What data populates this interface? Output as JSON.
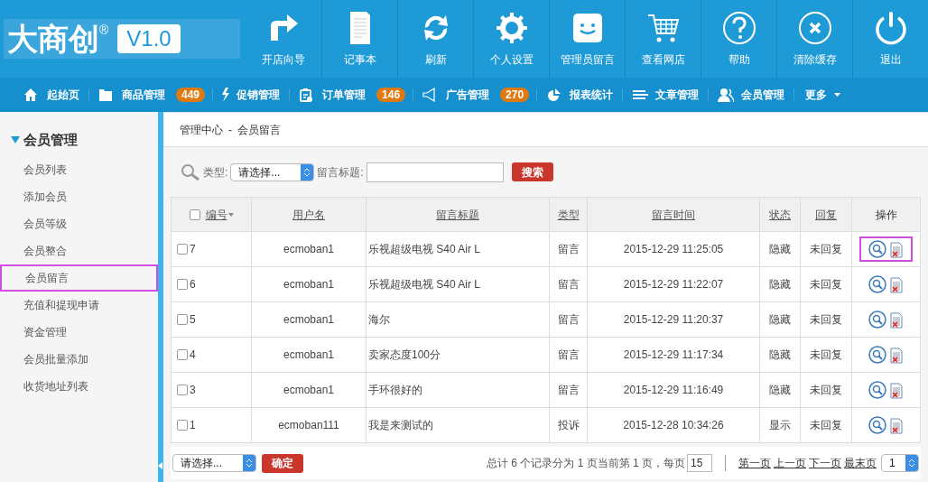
{
  "logo": {
    "text": "大商创",
    "mark": "®",
    "version": "V1.0"
  },
  "toolbar": [
    {
      "label": "开店向导",
      "kind": "arrow"
    },
    {
      "label": "记事本",
      "kind": "note"
    },
    {
      "label": "刷新",
      "kind": "refresh"
    },
    {
      "label": "个人设置",
      "kind": "gear"
    },
    {
      "label": "管理员留言",
      "kind": "smile"
    },
    {
      "label": "查看网店",
      "kind": "cart"
    },
    {
      "label": "帮助",
      "kind": "help"
    },
    {
      "label": "清除缓存",
      "kind": "clear"
    },
    {
      "label": "退出",
      "kind": "power"
    }
  ],
  "nav": [
    {
      "label": "起始页",
      "kind": "home"
    },
    {
      "label": "商品管理",
      "kind": "folder",
      "badge": "449"
    },
    {
      "label": "促销管理",
      "kind": "bolt"
    },
    {
      "label": "订单管理",
      "kind": "clipboard",
      "badge": "146"
    },
    {
      "label": "广告管理",
      "kind": "speaker",
      "badge": "270"
    },
    {
      "label": "报表统计",
      "kind": "pie"
    },
    {
      "label": "文章管理",
      "kind": "lines"
    },
    {
      "label": "会员管理",
      "kind": "users"
    },
    {
      "label": "更多",
      "kind": "dropdown"
    }
  ],
  "sidebar": {
    "title": "会员管理",
    "expanded": true,
    "items": [
      {
        "label": "会员列表",
        "selected": false
      },
      {
        "label": "添加会员",
        "selected": false
      },
      {
        "label": "会员等级",
        "selected": false
      },
      {
        "label": "会员整合",
        "selected": false
      },
      {
        "label": "会员留言",
        "selected": true
      },
      {
        "label": "充值和提现申请",
        "selected": false
      },
      {
        "label": "资金管理",
        "selected": false
      },
      {
        "label": "会员批量添加",
        "selected": false
      },
      {
        "label": "收货地址列表",
        "selected": false
      }
    ]
  },
  "breadcrumb": [
    "管理中心",
    "-",
    "会员留言"
  ],
  "filter": {
    "type_label": "类型:",
    "type_value": "请选择...",
    "title_label": "留言标题:",
    "search_button": "搜索"
  },
  "table": {
    "select_all_checked": false,
    "columns": [
      "编号",
      "用户名",
      "留言标题",
      "类型",
      "留言时间",
      "状态",
      "回复",
      "操作"
    ],
    "rows": [
      {
        "id": "7",
        "user": "ecmoban1",
        "title": "乐视超级电视 S40 Air L",
        "type": "留言",
        "time": "2015-12-29 11:25:05",
        "status": "隐藏",
        "reply": "未回复",
        "checked": false,
        "highlighted": true
      },
      {
        "id": "6",
        "user": "ecmoban1",
        "title": "乐视超级电视 S40 Air L",
        "type": "留言",
        "time": "2015-12-29 11:22:07",
        "status": "隐藏",
        "reply": "未回复",
        "checked": false,
        "highlighted": false
      },
      {
        "id": "5",
        "user": "ecmoban1",
        "title": "海尔",
        "type": "留言",
        "time": "2015-12-29 11:20:37",
        "status": "隐藏",
        "reply": "未回复",
        "checked": false,
        "highlighted": false
      },
      {
        "id": "4",
        "user": "ecmoban1",
        "title": "卖家态度100分",
        "type": "留言",
        "time": "2015-12-29 11:17:34",
        "status": "隐藏",
        "reply": "未回复",
        "checked": false,
        "highlighted": false
      },
      {
        "id": "3",
        "user": "ecmoban1",
        "title": "手环很好的",
        "type": "留言",
        "time": "2015-12-29 11:16:49",
        "status": "隐藏",
        "reply": "未回复",
        "checked": false,
        "highlighted": false
      },
      {
        "id": "1",
        "user": "ecmoban111",
        "title": "我是来测试的",
        "type": "投诉",
        "time": "2015-12-28 10:34:26",
        "status": "显示",
        "reply": "未回复",
        "checked": false,
        "highlighted": false
      }
    ]
  },
  "footer": {
    "batch_select": "请选择...",
    "confirm": "确定",
    "summary": "总计 6 个记录分为 1 页当前第 1 页，每页",
    "per_page": "15",
    "links": [
      "第一页",
      "上一页",
      "下一页",
      "最末页"
    ],
    "page": "1"
  }
}
